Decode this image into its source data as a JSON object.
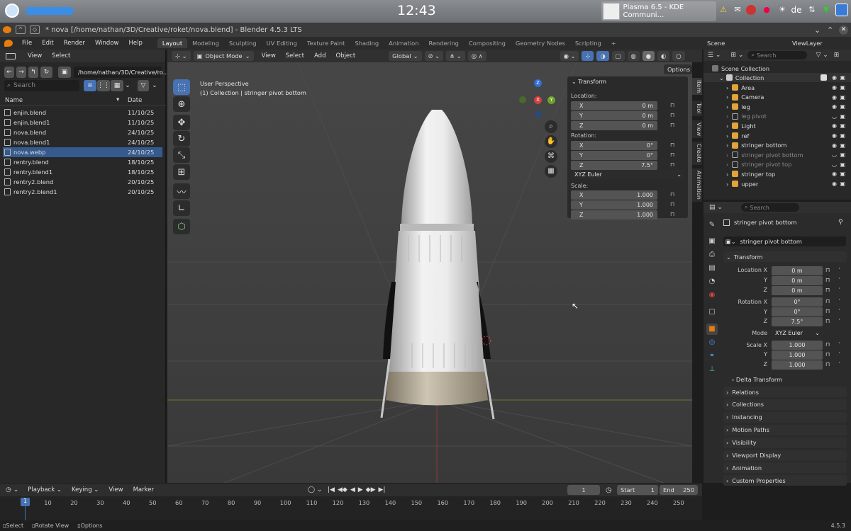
{
  "kde": {
    "clock": "12:43",
    "app_title": "Plasma 6.5 - KDE Communi...",
    "keyboard_layout": "de"
  },
  "window": {
    "title": "* nova [/home/nathan/3D/Creative/roket/nova.blend] - Blender 4.5.3 LTS"
  },
  "menus": [
    "File",
    "Edit",
    "Render",
    "Window",
    "Help"
  ],
  "workspaces": [
    "Layout",
    "Modeling",
    "Sculpting",
    "UV Editing",
    "Texture Paint",
    "Shading",
    "Animation",
    "Rendering",
    "Compositing",
    "Geometry Nodes",
    "Scripting"
  ],
  "active_workspace": "Layout",
  "scene": {
    "scene_label": "Scene",
    "viewlayer_label": "ViewLayer"
  },
  "filebrowser": {
    "menu_view": "View",
    "menu_select": "Select",
    "path": "/home/nathan/3D/Creative/ro...",
    "search_placeholder": "Search",
    "col_name": "Name",
    "col_date": "Date",
    "files": [
      {
        "name": "enjin.blend",
        "date": "11/10/25",
        "selected": false
      },
      {
        "name": "enjin.blend1",
        "date": "11/10/25",
        "selected": false
      },
      {
        "name": "nova.blend",
        "date": "24/10/25",
        "selected": false
      },
      {
        "name": "nova.blend1",
        "date": "24/10/25",
        "selected": false
      },
      {
        "name": "nova.webp",
        "date": "24/10/25",
        "selected": true
      },
      {
        "name": "rentry.blend",
        "date": "18/10/25",
        "selected": false
      },
      {
        "name": "rentry.blend1",
        "date": "18/10/25",
        "selected": false
      },
      {
        "name": "rentry2.blend",
        "date": "20/10/25",
        "selected": false
      },
      {
        "name": "rentry2.blend1",
        "date": "20/10/25",
        "selected": false
      }
    ]
  },
  "viewport": {
    "mode": "Object Mode",
    "menu_view": "View",
    "menu_select": "Select",
    "menu_add": "Add",
    "menu_object": "Object",
    "orientation": "Global",
    "options": "Options",
    "overlay_title": "User Perspective",
    "overlay_sub": "(1) Collection | stringer pivot bottom",
    "axis_x": "X",
    "axis_y": "Y",
    "axis_z": "Z"
  },
  "npanel": {
    "header": "Transform",
    "location_label": "Location:",
    "rotation_label": "Rotation:",
    "scale_label": "Scale:",
    "location": [
      {
        "axis": "X",
        "value": "0 m"
      },
      {
        "axis": "Y",
        "value": "0 m"
      },
      {
        "axis": "Z",
        "value": "0 m"
      }
    ],
    "rotation": [
      {
        "axis": "X",
        "value": "0°"
      },
      {
        "axis": "Y",
        "value": "0°"
      },
      {
        "axis": "Z",
        "value": "7.5°"
      }
    ],
    "rot_mode": "XYZ Euler",
    "scale": [
      {
        "axis": "X",
        "value": "1.000"
      },
      {
        "axis": "Y",
        "value": "1.000"
      },
      {
        "axis": "Z",
        "value": "1.000"
      }
    ],
    "tabs": [
      "Item",
      "Tool",
      "View",
      "Create",
      "Animation"
    ]
  },
  "outliner": {
    "search_placeholder": "Search",
    "root": "Scene Collection",
    "collection": "Collection",
    "items": [
      {
        "name": "Area",
        "dim": false,
        "icon": "light"
      },
      {
        "name": "Camera",
        "dim": false,
        "icon": "camera"
      },
      {
        "name": "leg",
        "dim": false,
        "icon": "mesh"
      },
      {
        "name": "leg pivot",
        "dim": true,
        "icon": "empty"
      },
      {
        "name": "Light",
        "dim": false,
        "icon": "light"
      },
      {
        "name": "ref",
        "dim": false,
        "icon": "image"
      },
      {
        "name": "stringer bottom",
        "dim": false,
        "icon": "mesh"
      },
      {
        "name": "stringer pivot bottom",
        "dim": true,
        "icon": "empty"
      },
      {
        "name": "stringer pivot top",
        "dim": true,
        "icon": "empty"
      },
      {
        "name": "stringer top",
        "dim": false,
        "icon": "mesh"
      },
      {
        "name": "upper",
        "dim": false,
        "icon": "mesh"
      }
    ]
  },
  "properties": {
    "search_placeholder": "Search",
    "object_name": "stringer pivot bottom",
    "object_field": "stringer pivot bottom",
    "transform_header": "Transform",
    "loc_label": "Location X",
    "y_label": "Y",
    "z_label": "Z",
    "rot_label": "Rotation X",
    "mode_label": "Mode",
    "scale_label": "Scale X",
    "location": [
      "0 m",
      "0 m",
      "0 m"
    ],
    "rotation": [
      "0°",
      "0°",
      "7.5°"
    ],
    "mode_value": "XYZ Euler",
    "scale": [
      "1.000",
      "1.000",
      "1.000"
    ],
    "delta": "Delta Transform",
    "sections": [
      "Relations",
      "Collections",
      "Instancing",
      "Motion Paths",
      "Visibility",
      "Viewport Display",
      "Animation",
      "Custom Properties"
    ]
  },
  "timeline": {
    "playback": "Playback",
    "keying": "Keying",
    "view": "View",
    "marker": "Marker",
    "current_frame": "1",
    "start_label": "Start",
    "start": "1",
    "end_label": "End",
    "end": "250",
    "ticks": [
      "1",
      "10",
      "20",
      "30",
      "40",
      "50",
      "60",
      "70",
      "80",
      "90",
      "100",
      "110",
      "120",
      "130",
      "140",
      "150",
      "160",
      "170",
      "180",
      "190",
      "200",
      "210",
      "220",
      "230",
      "240",
      "250"
    ]
  },
  "status": {
    "select": "Select",
    "rotate": "Rotate View",
    "options": "Options",
    "version": "4.5.3"
  }
}
